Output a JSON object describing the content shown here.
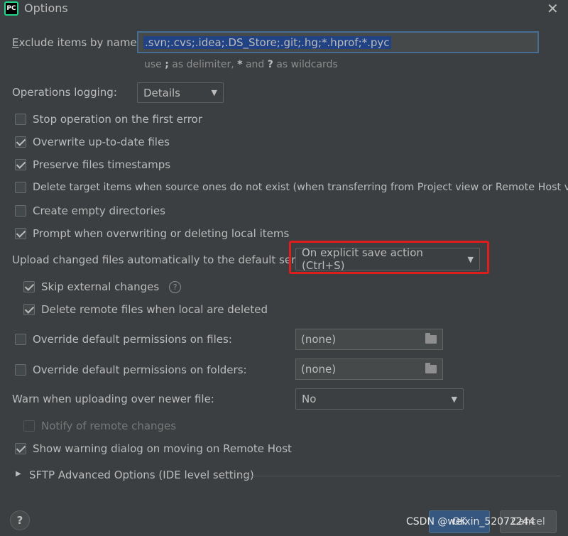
{
  "window": {
    "title": "Options",
    "close_glyph": "✕",
    "app_icon_text": "PC"
  },
  "exclude": {
    "label": "Exclude items by name:",
    "value": ".svn;.cvs;.idea;.DS_Store;.git;.hg;*.hprof;*.pyc",
    "hint_pre": "use ",
    "hint_semicolon": ";",
    "hint_mid": " as delimiter, ",
    "hint_star": "*",
    "hint_and": " and ",
    "hint_q": "?",
    "hint_post": " as wildcards"
  },
  "logging": {
    "label": "Operations logging:",
    "value": "Details"
  },
  "checks": [
    {
      "label": "Stop operation on the first error",
      "checked": false
    },
    {
      "label": "Overwrite up-to-date files",
      "checked": true
    },
    {
      "label": "Preserve files timestamps",
      "checked": true
    },
    {
      "label": "Delete target items when source ones do not exist (when transferring from Project view or Remote Host view)",
      "checked": false
    },
    {
      "label": "Create empty directories",
      "checked": false
    },
    {
      "label": "Prompt when overwriting or deleting local items",
      "checked": true
    }
  ],
  "upload": {
    "label": "Upload changed files automatically to the default server",
    "value": "On explicit save action (Ctrl+S)"
  },
  "sub_checks": [
    {
      "label": "Skip external changes",
      "checked": true
    },
    {
      "label": "Delete remote files when local are deleted",
      "checked": true
    }
  ],
  "perm_files": {
    "label": "Override default permissions on files:",
    "value": "(none)"
  },
  "perm_folders": {
    "label": "Override default permissions on folders:",
    "value": "(none)"
  },
  "warn": {
    "label": "Warn when uploading over newer file:",
    "value": "No"
  },
  "notify": {
    "label": "Notify of remote changes"
  },
  "show_warning": {
    "label": "Show warning dialog on moving on Remote Host"
  },
  "sftp": {
    "label": "SFTP Advanced Options (IDE level setting)",
    "expander": "▶"
  },
  "footer": {
    "help": "?",
    "ok": "OK",
    "cancel": "Cancel",
    "watermark": "CSDN @weixin_52072244"
  },
  "colors": {
    "highlight": "#e01d1d",
    "selection": "#214283",
    "background": "#3c3f41"
  },
  "icons": {
    "combo_arrow": "▼",
    "help": "?"
  }
}
